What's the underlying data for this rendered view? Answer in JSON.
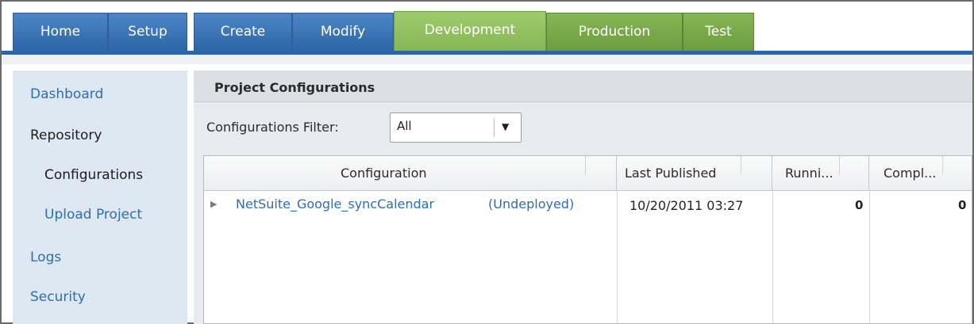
{
  "tabs": [
    {
      "label": "Home",
      "color": "#2d66a8"
    },
    {
      "label": "Setup",
      "color": "#2d66a8"
    },
    {
      "label": "Create",
      "color": "#2d66a8"
    },
    {
      "label": "Modify",
      "color": "#2d66a8"
    },
    {
      "label": "Development",
      "color": "#86b556",
      "active": true
    },
    {
      "label": "Production",
      "color": "#6e9c40"
    },
    {
      "label": "Test",
      "color": "#6e9c40"
    }
  ],
  "sidebar": {
    "items": [
      {
        "label": "Dashboard"
      },
      {
        "label": "Repository"
      },
      {
        "label": "Configurations"
      },
      {
        "label": "Upload Project"
      },
      {
        "label": "Logs"
      },
      {
        "label": "Security"
      }
    ]
  },
  "main": {
    "title": "Project Configurations",
    "filter": {
      "label": "Configurations Filter:",
      "value": "All"
    }
  },
  "grid": {
    "columns": [
      "Configuration",
      "Last Published",
      "Runni...",
      "Compl..."
    ],
    "rows": [
      {
        "name": "NetSuite_Google_syncCalendar",
        "status": "(Undeployed)",
        "last_published": "10/20/2011 03:27",
        "running": "0",
        "completed": "0"
      }
    ]
  }
}
